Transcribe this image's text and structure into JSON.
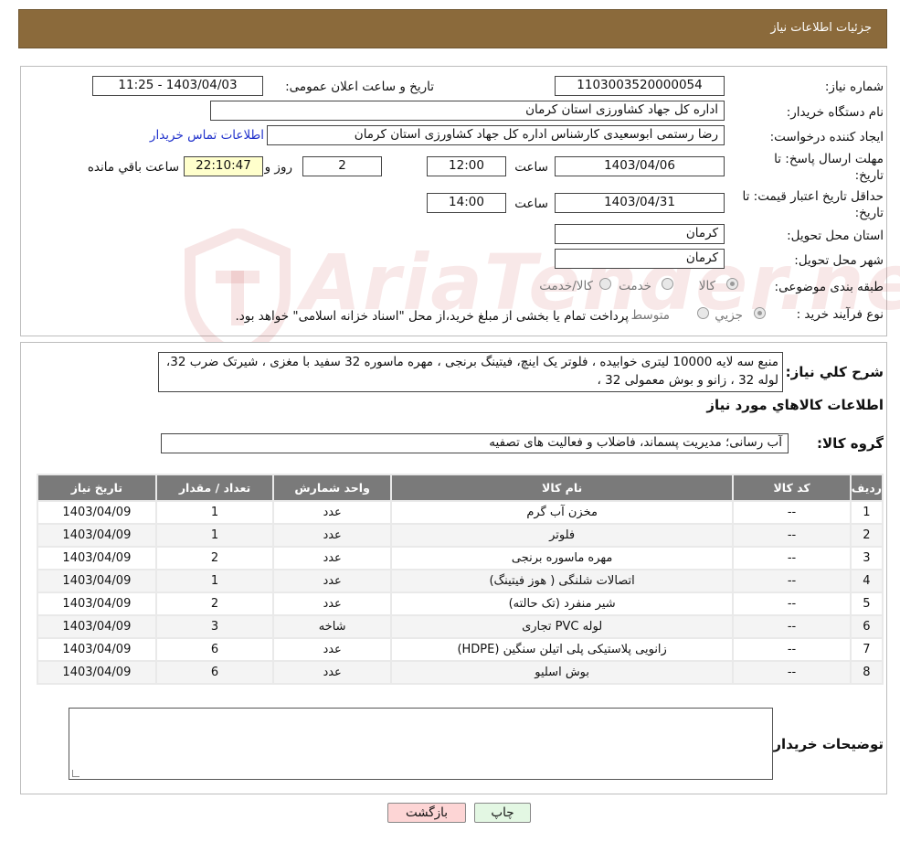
{
  "header": {
    "title": "جزئیات اطلاعات نیاز"
  },
  "form": {
    "need_number_label": "شماره نیاز:",
    "need_number": "1103003520000054",
    "announce_label": "تاریخ و ساعت اعلان عمومی:",
    "announce_value": "1403/04/03 - 11:25",
    "buyer_org_label": "نام دستگاه خریدار:",
    "buyer_org": "اداره کل جهاد کشاورزی استان کرمان",
    "creator_label": "ایجاد کننده درخواست:",
    "creator": "رضا رستمی ابوسعیدی کارشناس اداره کل جهاد کشاورزی استان کرمان",
    "contact_link": "اطلاعات تماس خریدار",
    "reply_deadline_label_1": "مهلت ارسال پاسخ: تا",
    "reply_deadline_label_2": "تاریخ:",
    "reply_date": "1403/04/06",
    "time_label": "ساعت",
    "reply_time": "12:00",
    "days_value": "2",
    "days_label": "روز و",
    "remaining_time": "22:10:47",
    "remaining_label": "ساعت باقي مانده",
    "price_validity_label_1": "حداقل تاریخ اعتبار قیمت: تا",
    "price_validity_label_2": "تاریخ:",
    "price_date": "1403/04/31",
    "price_time": "14:00",
    "province_label": "استان محل تحویل:",
    "province": "کرمان",
    "city_label": "شهر محل تحویل:",
    "city": "کرمان",
    "category_label": "طبقه بندی موضوعی:",
    "category_options": [
      "کالا",
      "خدمت",
      "کالا/خدمت"
    ],
    "process_label": "نوع فرآیند خرید :",
    "process_options": [
      "جزیي",
      "متوسط"
    ],
    "process_note": "پرداخت تمام یا بخشی از مبلغ خرید،از محل \"اسناد خزانه اسلامی\" خواهد بود."
  },
  "description": {
    "label": "شرح کلي نياز:",
    "text": "منبع سه لایه 10000 لیتری خوابیده ، فلوتر یک اینچ، فیتینگ برنجی ، مهره ماسوره 32 سفید با مغزی ، شیرتک ضرب 32، لوله 32 ، زانو  و بوش معمولی 32 ،"
  },
  "items_section": {
    "title": "اطلاعات کالاهاي مورد نياز",
    "group_label": "گروه کالا:",
    "group_value": "آب رسانی؛ مدیریت پسماند، فاضلاب و فعالیت های تصفیه",
    "columns": [
      "رديف",
      "کد کالا",
      "نام کالا",
      "واحد شمارش",
      "تعداد / مقدار",
      "تاریخ نیاز"
    ],
    "rows": [
      [
        "1",
        "--",
        "مخزن آب گرم",
        "عدد",
        "1",
        "1403/04/09"
      ],
      [
        "2",
        "--",
        "فلوتر",
        "عدد",
        "1",
        "1403/04/09"
      ],
      [
        "3",
        "--",
        "مهره ماسوره برنجی",
        "عدد",
        "2",
        "1403/04/09"
      ],
      [
        "4",
        "--",
        "اتصالات شلنگی ( هوز فیتینگ)",
        "عدد",
        "1",
        "1403/04/09"
      ],
      [
        "5",
        "--",
        "شیر منفرد (تک حالته)",
        "عدد",
        "2",
        "1403/04/09"
      ],
      [
        "6",
        "--",
        "لوله PVC تجاری",
        "شاخه",
        "3",
        "1403/04/09"
      ],
      [
        "7",
        "--",
        "زانویی پلاستیکی پلی اتیلن سنگین (HDPE)",
        "عدد",
        "6",
        "1403/04/09"
      ],
      [
        "8",
        "--",
        "بوش اسلیو",
        "عدد",
        "6",
        "1403/04/09"
      ]
    ]
  },
  "buyer_notes": {
    "label": "توضیحات خریدار:",
    "text": ""
  },
  "buttons": {
    "print": "چاپ",
    "back": "بازگشت"
  },
  "watermark": {
    "text": "AriaTender.neT"
  },
  "colors": {
    "header_bg": "#8b6a3b",
    "table_header": "#7a7a7a",
    "link": "#2233cc",
    "back_button": "#fdd5d5",
    "print_button": "#e3f7e3"
  }
}
